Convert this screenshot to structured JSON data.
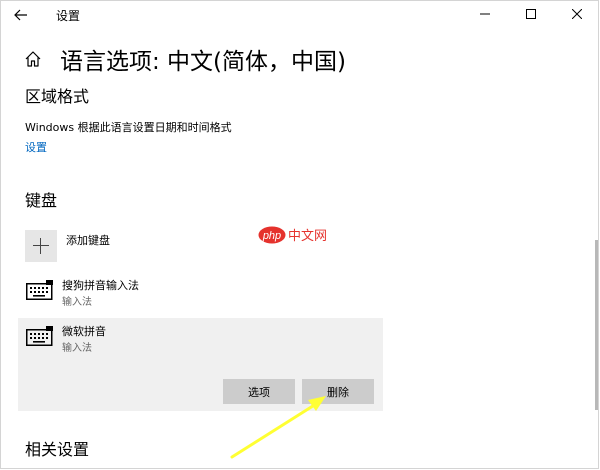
{
  "window": {
    "title": "设置"
  },
  "page": {
    "title": "语言选项: 中文(简体，中国)"
  },
  "region_format": {
    "heading": "区域格式",
    "description": "Windows 根据此语言设置日期和时间格式",
    "settings_link": "设置"
  },
  "keyboard": {
    "heading": "键盘",
    "add_label": "添加键盘",
    "items": [
      {
        "name": "搜狗拼音输入法",
        "type": "输入法"
      },
      {
        "name": "微软拼音",
        "type": "输入法"
      }
    ],
    "options_button": "选项",
    "delete_button": "删除"
  },
  "related": {
    "heading": "相关设置"
  },
  "watermark": {
    "text": "中文网"
  },
  "colors": {
    "accent": "#0067c0",
    "selected_bg": "#f0f0f0",
    "button_bg": "#cccccc",
    "arrow": "#ffff33"
  }
}
